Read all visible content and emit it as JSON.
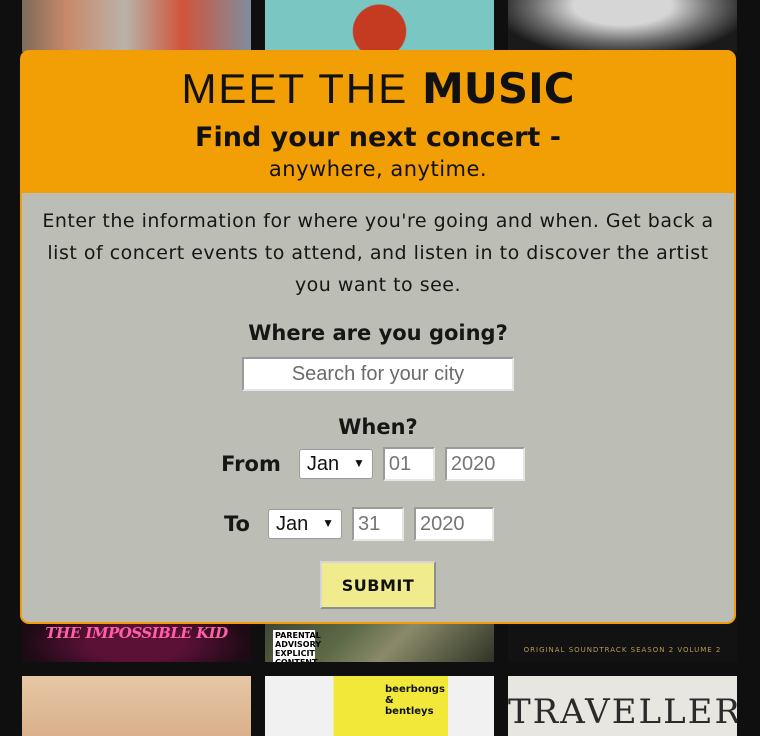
{
  "brand": {
    "prefix": "MEET THE",
    "emphasis": "MUSIC"
  },
  "tagline": "Find your next concert -",
  "subtagline": "anywhere, anytime.",
  "intro": "Enter the information for where you're going and when. Get back a list of concert events to attend, and listen in to discover the artist you want to see.",
  "where": {
    "label": "Where are you going?",
    "placeholder": "Search for your city",
    "value": ""
  },
  "when": {
    "label": "When?",
    "from": {
      "label": "From",
      "month": "Jan",
      "day": "01",
      "year": "2020"
    },
    "to": {
      "label": "To",
      "month": "Jan",
      "day": "31",
      "year": "2020"
    }
  },
  "submit_label": "SUBMIT",
  "background_albums": {
    "tile4_text": "THE IMPOSSIBLE KID",
    "tile5_text": "PARENTAL ADVISORY EXPLICIT CONTENT",
    "tile6_text": "ORIGINAL SOUNDTRACK SEASON 2 VOLUME 2",
    "tile8_text": "beerbongs & bentleys",
    "tile9_text": "TRAVELLER"
  },
  "colors": {
    "header_bg": "#f29e05",
    "modal_bg": "#bcbdb4",
    "submit_bg": "#f0ec8d",
    "page_bg": "#0f0f0f"
  }
}
